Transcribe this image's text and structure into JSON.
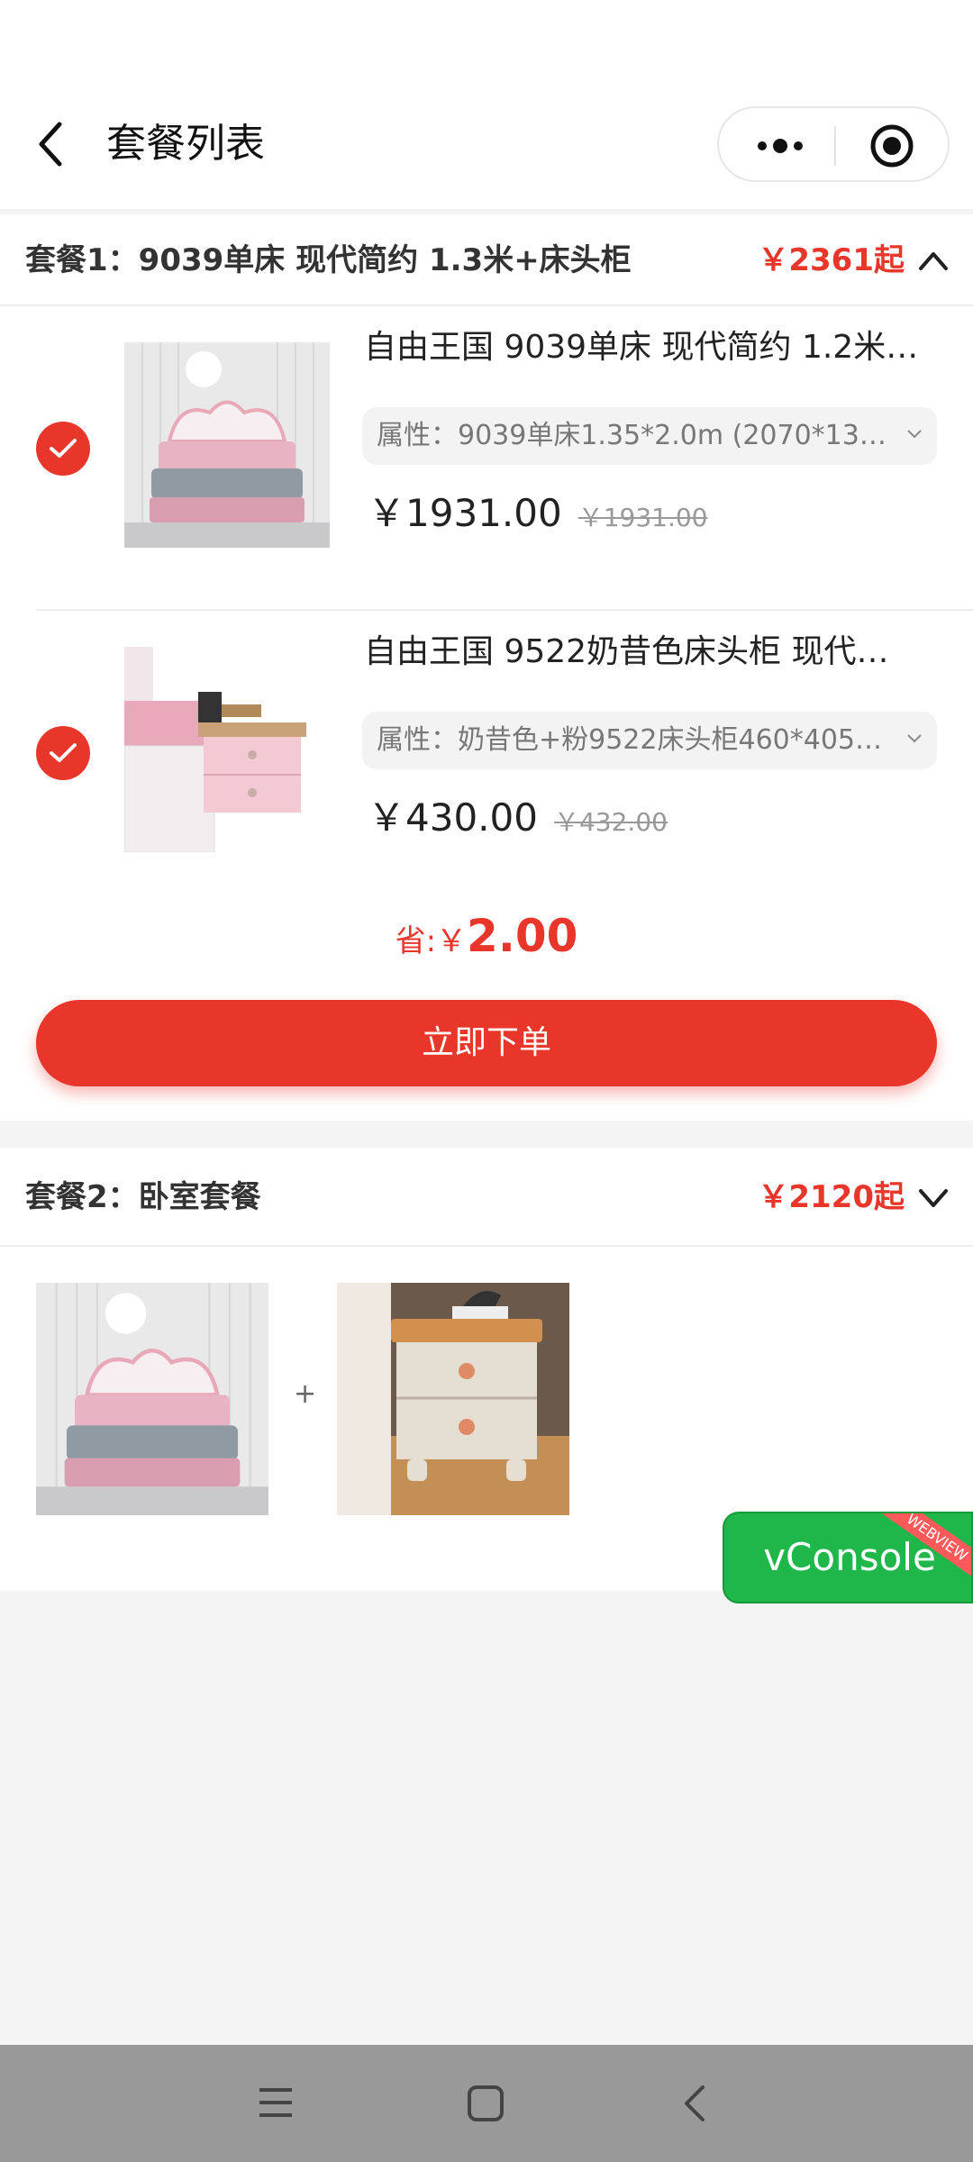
{
  "header": {
    "title": "套餐列表",
    "back_icon": "chevron-left-icon",
    "more_icon": "more-dots-icon",
    "close_icon": "target-icon"
  },
  "packages": [
    {
      "title": "套餐1：9039单床 现代简约 1.3米+床头柜",
      "price": "￥2361起",
      "expanded": true,
      "items": [
        {
          "title": "自由王国 9039单床 现代简约 1.2米…",
          "attr": "属性：9039单床1.35*2.0m (2070*13…",
          "price": "￥1931.00",
          "old_price": "￥1931.00",
          "checked": true
        },
        {
          "title": "自由王国 9522奶昔色床头柜 现代…",
          "attr": "属性：奶昔色+粉9522床头柜460*405…",
          "price": "￥430.00",
          "old_price": "￥432.00",
          "checked": true
        }
      ],
      "save_label": "省:",
      "save_currency": "￥",
      "save_amount": "2.00",
      "order_button": "立即下单"
    },
    {
      "title": "套餐2：卧室套餐",
      "price": "￥2120起",
      "expanded": false,
      "plus": "+"
    }
  ],
  "vconsole": {
    "label": "vConsole",
    "ribbon": "WEBVIEW"
  },
  "colors": {
    "accent": "#e8362b",
    "vconsole": "#1fb749"
  }
}
